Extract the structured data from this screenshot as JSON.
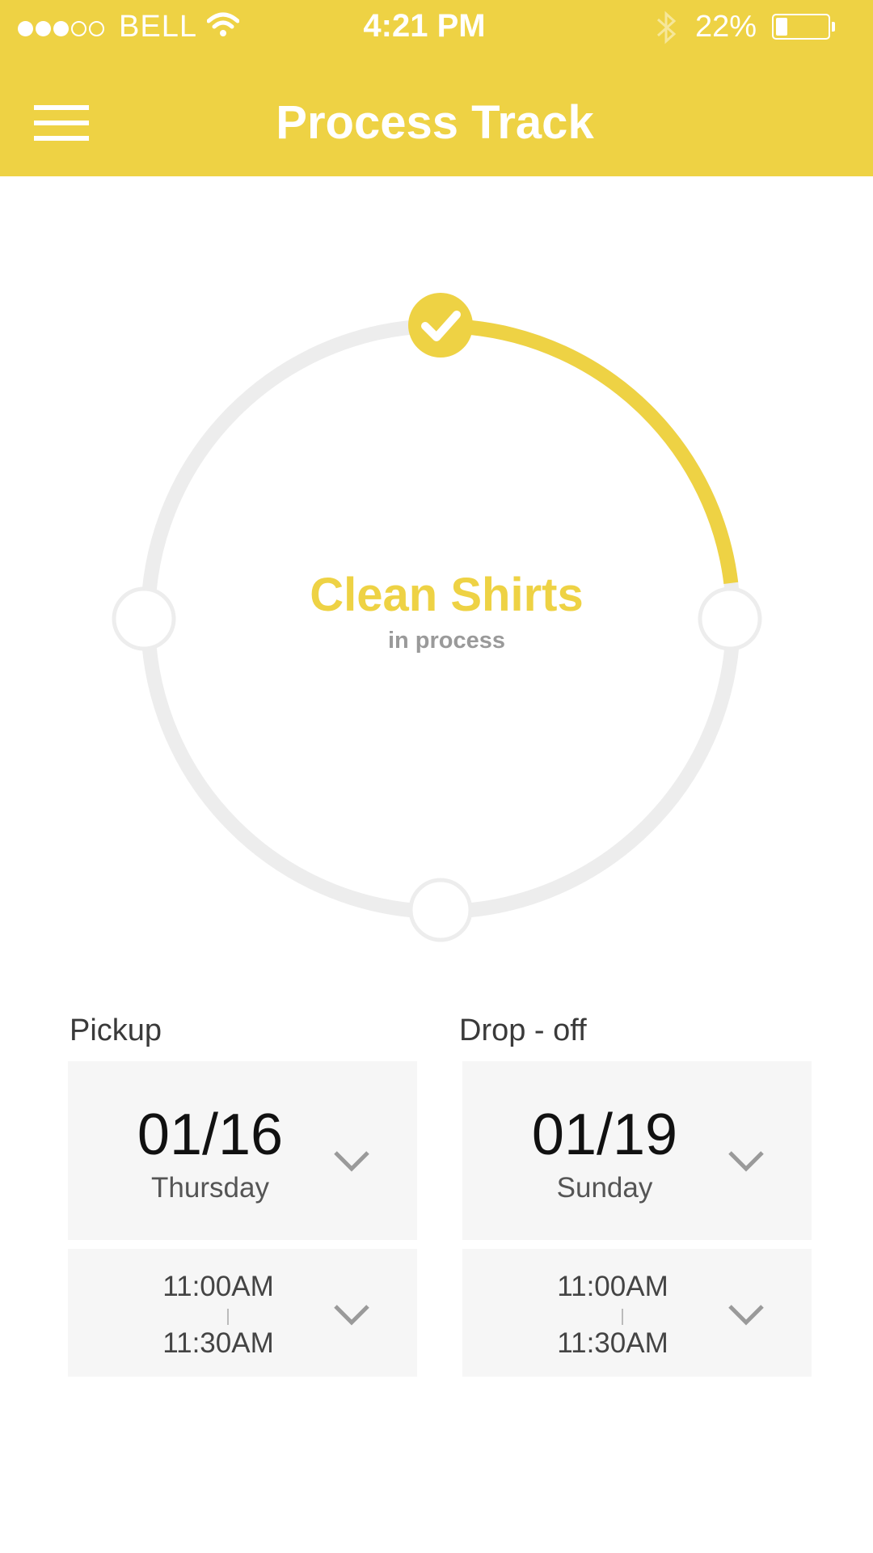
{
  "status_bar": {
    "carrier": "BELL",
    "time": "4:21 PM",
    "battery_percent": "22%",
    "battery_level": 0.22,
    "signal_bars_filled": 3,
    "signal_bars_total": 5
  },
  "header": {
    "title": "Process Track"
  },
  "process": {
    "item_name": "Clean Shirts",
    "status": "in process",
    "progress_fraction": 0.25,
    "steps_total": 4,
    "steps_completed": 1
  },
  "pickup": {
    "label": "Pickup",
    "date": "01/16",
    "day": "Thursday",
    "time_start": "11:00AM",
    "time_end": "11:30AM"
  },
  "dropoff": {
    "label": "Drop - off",
    "date": "01/19",
    "day": "Sunday",
    "time_start": "11:00AM",
    "time_end": "11:30AM"
  },
  "colors": {
    "accent": "#EED244",
    "track": "#EDEDED",
    "card": "#F6F6F6"
  },
  "icons": [
    "menu-icon",
    "wifi-icon",
    "bluetooth-icon",
    "battery-icon",
    "check-icon",
    "chevron-down-icon"
  ]
}
